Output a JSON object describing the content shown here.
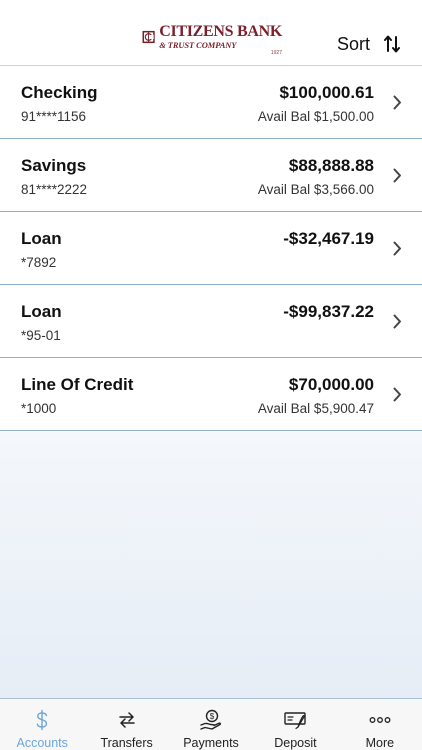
{
  "header": {
    "logo": {
      "name": "CITIZENS BANK",
      "sub": "& TRUST COMPANY",
      "est": "1927"
    },
    "sort_label": "Sort",
    "sort_icon": "sort-arrows-icon"
  },
  "accounts": [
    {
      "name": "Checking",
      "number": "91****1156",
      "balance": "$100,000.61",
      "avail": "Avail Bal $1,500.00"
    },
    {
      "name": "Savings",
      "number": "81****2222",
      "balance": "$88,888.88",
      "avail": "Avail Bal $3,566.00"
    },
    {
      "name": "Loan",
      "number": "*7892",
      "balance": "-$32,467.19",
      "avail": ""
    },
    {
      "name": "Loan",
      "number": "*95-01",
      "balance": "-$99,837.22",
      "avail": ""
    },
    {
      "name": "Line Of Credit",
      "number": "*1000",
      "balance": "$70,000.00",
      "avail": "Avail Bal $5,900.47"
    }
  ],
  "tabs": [
    {
      "label": "Accounts",
      "icon": "dollar-icon",
      "active": true
    },
    {
      "label": "Transfers",
      "icon": "transfer-arrows-icon",
      "active": false
    },
    {
      "label": "Payments",
      "icon": "hand-coin-icon",
      "active": false
    },
    {
      "label": "Deposit",
      "icon": "check-deposit-icon",
      "active": false
    },
    {
      "label": "More",
      "icon": "more-dots-icon",
      "active": false
    }
  ],
  "colors": {
    "brand": "#7a1f2b",
    "accent": "#6ea6d8",
    "divider": "#8fb0c9"
  }
}
